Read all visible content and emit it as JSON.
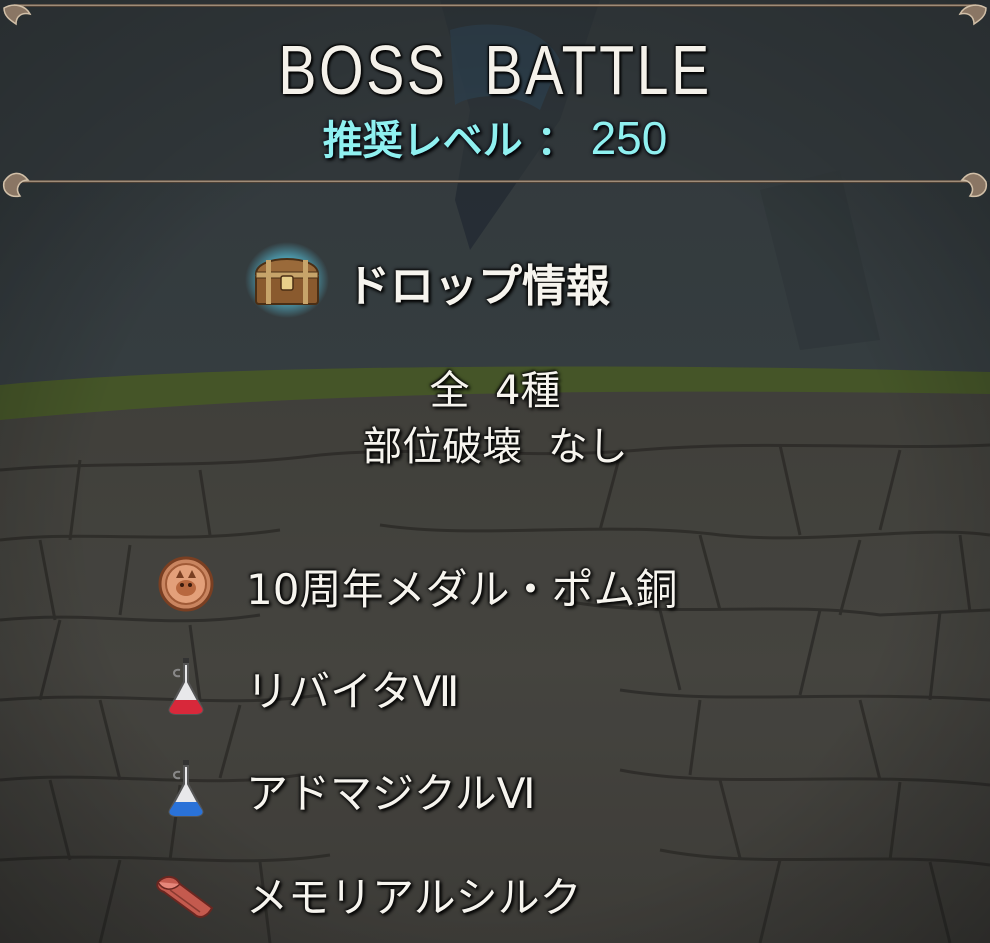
{
  "header": {
    "title": "BOSS  BATTLE",
    "level_label": "推奨レベル ：",
    "level_value": "250"
  },
  "drop": {
    "title": "ドロップ情報",
    "total": "全  4種",
    "part_break": "部位破壊  なし",
    "items": [
      {
        "name": "10周年メダル・ポム銅",
        "icon": "medal-icon"
      },
      {
        "name": "リバイタⅦ",
        "icon": "red-potion-icon"
      },
      {
        "name": "アドマジクルⅥ",
        "icon": "blue-potion-icon"
      },
      {
        "name": "メモリアルシルク",
        "icon": "silk-cloth-icon"
      }
    ]
  },
  "colors": {
    "level_text": "#8ff0f0",
    "body_text": "#f6f4ee",
    "frame": "#b8a48e"
  }
}
